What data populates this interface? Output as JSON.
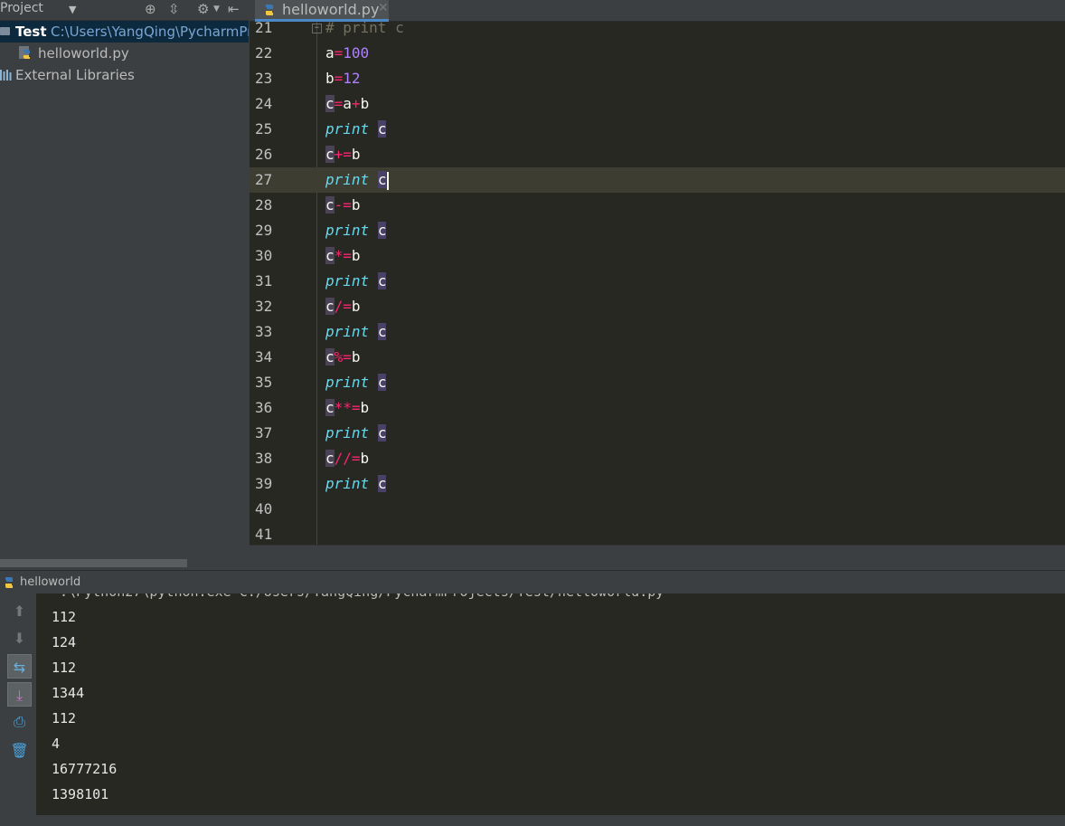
{
  "sidebar": {
    "title": "Project",
    "root": {
      "name": "Test",
      "path": "C:\\Users\\YangQing\\PycharmPr"
    },
    "file": "helloworld.py",
    "libraries": "External Libraries"
  },
  "editor": {
    "tab_label": "helloworld.py",
    "tab_close": "✕",
    "lines": [
      {
        "n": "21",
        "segs": [
          {
            "t": "# print c",
            "c": "comment"
          }
        ]
      },
      {
        "n": "22",
        "segs": [
          {
            "t": "a"
          },
          {
            "t": "=",
            "c": "op"
          },
          {
            "t": "100",
            "c": "num"
          }
        ]
      },
      {
        "n": "23",
        "segs": [
          {
            "t": "b"
          },
          {
            "t": "=",
            "c": "op"
          },
          {
            "t": "12",
            "c": "num"
          }
        ]
      },
      {
        "n": "24",
        "segs": [
          {
            "t": "c",
            "c": "var"
          },
          {
            "t": "=",
            "c": "op"
          },
          {
            "t": "a"
          },
          {
            "t": "+",
            "c": "op"
          },
          {
            "t": "b"
          }
        ]
      },
      {
        "n": "25",
        "segs": [
          {
            "t": "print",
            "c": "kw"
          },
          {
            "t": " "
          },
          {
            "t": "c",
            "c": "var-hl"
          }
        ]
      },
      {
        "n": "26",
        "segs": [
          {
            "t": "c",
            "c": "var"
          },
          {
            "t": "+=",
            "c": "op"
          },
          {
            "t": "b"
          }
        ]
      },
      {
        "n": "27",
        "current": true,
        "segs": [
          {
            "t": "print",
            "c": "kw"
          },
          {
            "t": " "
          },
          {
            "t": "c",
            "c": "var-hl"
          }
        ]
      },
      {
        "n": "28",
        "segs": [
          {
            "t": "c",
            "c": "var"
          },
          {
            "t": "-=",
            "c": "op"
          },
          {
            "t": "b"
          }
        ]
      },
      {
        "n": "29",
        "segs": [
          {
            "t": "print",
            "c": "kw"
          },
          {
            "t": " "
          },
          {
            "t": "c",
            "c": "var-hl"
          }
        ]
      },
      {
        "n": "30",
        "segs": [
          {
            "t": "c",
            "c": "var"
          },
          {
            "t": "*=",
            "c": "op"
          },
          {
            "t": "b"
          }
        ]
      },
      {
        "n": "31",
        "segs": [
          {
            "t": "print",
            "c": "kw"
          },
          {
            "t": " "
          },
          {
            "t": "c",
            "c": "var-hl"
          }
        ]
      },
      {
        "n": "32",
        "segs": [
          {
            "t": "c",
            "c": "var"
          },
          {
            "t": "/=",
            "c": "op"
          },
          {
            "t": "b"
          }
        ]
      },
      {
        "n": "33",
        "segs": [
          {
            "t": "print",
            "c": "kw"
          },
          {
            "t": " "
          },
          {
            "t": "c",
            "c": "var-hl"
          }
        ]
      },
      {
        "n": "34",
        "segs": [
          {
            "t": "c",
            "c": "var"
          },
          {
            "t": "%=",
            "c": "op"
          },
          {
            "t": "b"
          }
        ]
      },
      {
        "n": "35",
        "segs": [
          {
            "t": "print",
            "c": "kw"
          },
          {
            "t": " "
          },
          {
            "t": "c",
            "c": "var-hl"
          }
        ]
      },
      {
        "n": "36",
        "segs": [
          {
            "t": "c",
            "c": "var"
          },
          {
            "t": "**=",
            "c": "op"
          },
          {
            "t": "b"
          }
        ]
      },
      {
        "n": "37",
        "segs": [
          {
            "t": "print",
            "c": "kw"
          },
          {
            "t": " "
          },
          {
            "t": "c",
            "c": "var-hl"
          }
        ]
      },
      {
        "n": "38",
        "segs": [
          {
            "t": "c",
            "c": "var"
          },
          {
            "t": "//=",
            "c": "op"
          },
          {
            "t": "b"
          }
        ]
      },
      {
        "n": "39",
        "segs": [
          {
            "t": "print",
            "c": "kw"
          },
          {
            "t": " "
          },
          {
            "t": "c",
            "c": "var-hl"
          }
        ]
      },
      {
        "n": "40",
        "segs": []
      },
      {
        "n": "41",
        "segs": []
      }
    ]
  },
  "run": {
    "title": "helloworld",
    "output": [
      "112",
      "124",
      "112",
      "1344",
      "112",
      "4",
      "16777216",
      "1398101"
    ],
    "toolbar": [
      "up-arrow-icon",
      "down-arrow-icon",
      "soft-wrap-icon",
      "scroll-to-end-icon",
      "print-icon",
      "trash-icon"
    ]
  },
  "colors": {
    "editor_bg": "#272822",
    "keyword": "#66d9ef",
    "number": "#ae81ff",
    "operator": "#f92672",
    "comment": "#75715e",
    "selection_path": "#7aa5d2",
    "tab_underline": "#4a88c7"
  }
}
